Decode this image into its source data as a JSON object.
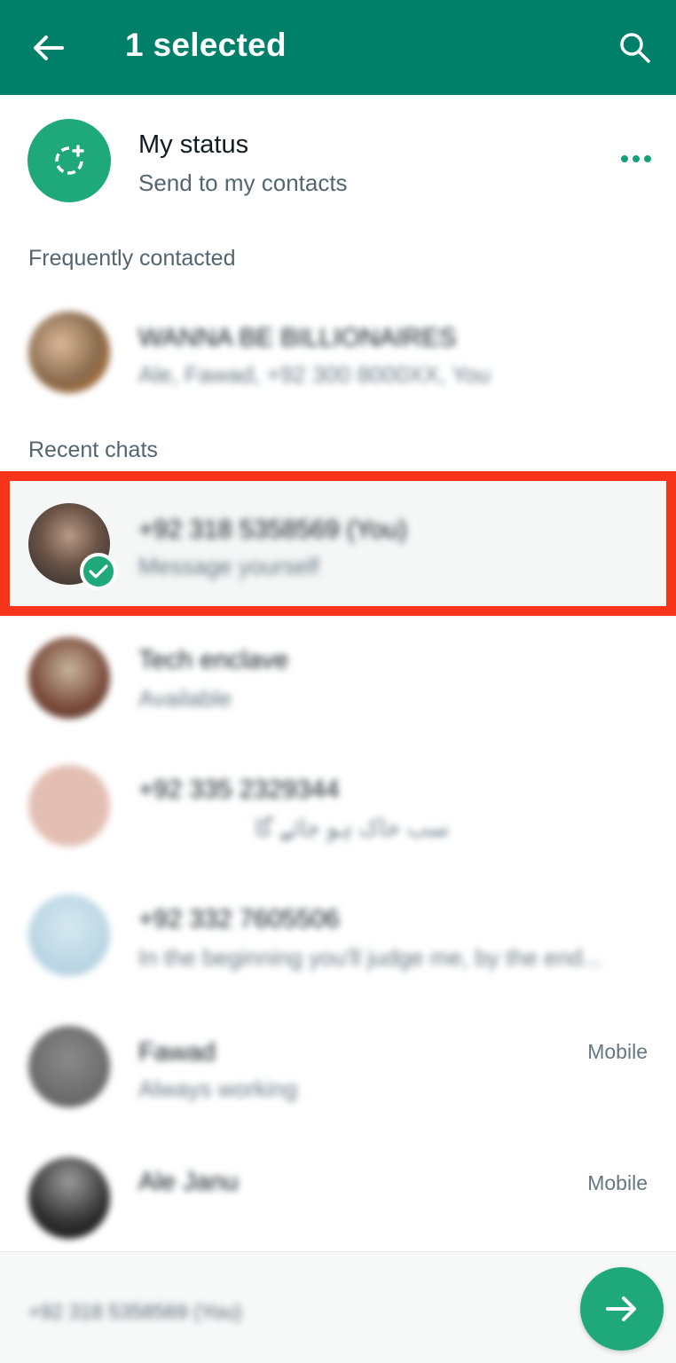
{
  "header": {
    "title": "1 selected",
    "back_icon": "arrow-left-icon",
    "search_icon": "search-icon",
    "background": "#008069"
  },
  "my_status": {
    "title": "My status",
    "subtitle": "Send to my contacts",
    "icon": "status-add-icon",
    "more_icon": "more-horizontal-icon"
  },
  "sections": {
    "frequent": "Frequently contacted",
    "recent": "Recent chats"
  },
  "frequent_chats": [
    {
      "name": "WANNA BE BILLIONAIRES",
      "subtitle": "Ale, Fawad, +92 300 8000XX, You"
    }
  ],
  "recent_chats": [
    {
      "name": "+92 318 5358569 (You)",
      "subtitle": "Message yourself",
      "selected": true
    },
    {
      "name": "Tech enclave",
      "subtitle": "Available"
    },
    {
      "name": "+92 335 2329344",
      "subtitle": "سب خاک ہو جائے گا"
    },
    {
      "name": "+92 332 7605506",
      "subtitle": "In the beginning you'll judge me, by the end..."
    },
    {
      "name": "Fawad",
      "subtitle": "Always working",
      "tag": "Mobile"
    },
    {
      "name": "Ale Janu",
      "subtitle": "",
      "tag": "Mobile"
    }
  ],
  "bottom_bar": {
    "selected_text": "+92 318 5358569 (You)",
    "send_icon": "arrow-right-icon"
  },
  "colors": {
    "accent": "#1fa97b",
    "header": "#008069",
    "highlight_border": "#f7331a"
  }
}
